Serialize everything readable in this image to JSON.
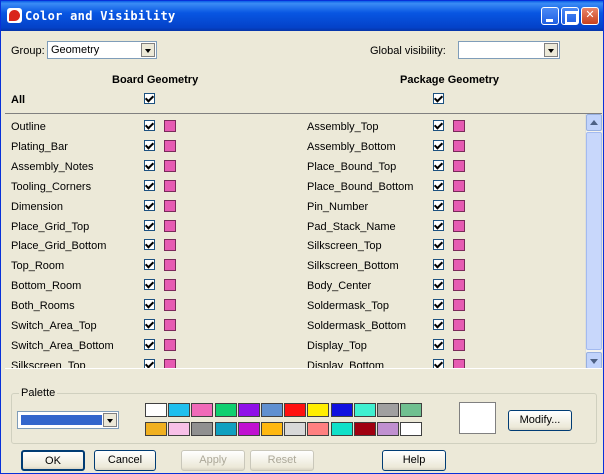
{
  "window": {
    "title": "Color and Visibility"
  },
  "group": {
    "label": "Group:",
    "value": "Geometry"
  },
  "global_visibility": {
    "label": "Global visibility:",
    "value": ""
  },
  "columns": {
    "left": "Board Geometry",
    "right": "Package Geometry"
  },
  "all_label": "All",
  "swatch_color": "#e65bb2",
  "rows_left": [
    "Outline",
    "Plating_Bar",
    "Assembly_Notes",
    "Tooling_Corners",
    "Dimension",
    "Place_Grid_Top",
    "Place_Grid_Bottom",
    "Top_Room",
    "Bottom_Room",
    "Both_Rooms",
    "Switch_Area_Top",
    "Switch_Area_Bottom",
    "Silkscreen_Top"
  ],
  "rows_right": [
    "Assembly_Top",
    "Assembly_Bottom",
    "Place_Bound_Top",
    "Place_Bound_Bottom",
    "Pin_Number",
    "Pad_Stack_Name",
    "Silkscreen_Top",
    "Silkscreen_Bottom",
    "Body_Center",
    "Soldermask_Top",
    "Soldermask_Bottom",
    "Display_Top",
    "Display_Bottom"
  ],
  "palette": {
    "label": "Palette",
    "selected_color": "#3366cc",
    "row1": [
      "#ffffff",
      "#1fbfee",
      "#f06ab8",
      "#10d070",
      "#9010e8",
      "#6090d0",
      "#ff1010",
      "#ffee00",
      "#1010e0",
      "#40f0d0",
      "#a0a0a0",
      "#70c090"
    ],
    "row2": [
      "#f0b020",
      "#f8c0e8",
      "#909090",
      "#10a0c0",
      "#c010d0",
      "#ffb810",
      "#d8d8d8",
      "#ff8080",
      "#10e0c8",
      "#a00010",
      "#c090d0",
      "#ffffff"
    ],
    "preview_color": "#ffffff",
    "modify": "Modify..."
  },
  "buttons": {
    "ok": "OK",
    "cancel": "Cancel",
    "apply": "Apply",
    "reset": "Reset",
    "help": "Help"
  }
}
